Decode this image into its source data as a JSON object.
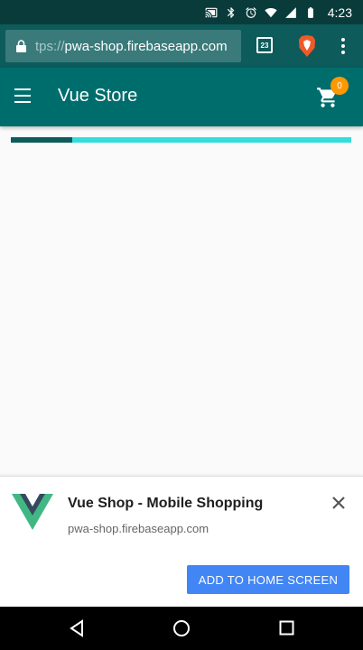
{
  "status_bar": {
    "time": "4:23",
    "icons": [
      "cast-icon",
      "bluetooth-icon",
      "alarm-icon",
      "wifi-icon",
      "signal-icon",
      "battery-icon"
    ]
  },
  "browser": {
    "url_prefix": "tps://",
    "url_main": "pwa-shop.firebaseapp.com",
    "tab_count": "23",
    "colors": {
      "chrome": "#0d5b5b",
      "url_box": "#3a7a7a"
    }
  },
  "app_bar": {
    "title": "Vue Store",
    "cart_count": "0",
    "colors": {
      "toolbar": "#006d6d",
      "badge": "#ff9800"
    }
  },
  "loading": {
    "progress_fraction": 0.18,
    "colors": {
      "fill": "#0d5b5b",
      "track": "#33dddd"
    }
  },
  "install_prompt": {
    "title": "Vue Shop - Mobile Shopping",
    "url": "pwa-shop.firebaseapp.com",
    "button_label": "ADD TO HOME SCREEN",
    "colors": {
      "button": "#4285f4"
    }
  },
  "nav_bar": {
    "icons": [
      "back-icon",
      "home-icon",
      "recents-icon"
    ]
  }
}
